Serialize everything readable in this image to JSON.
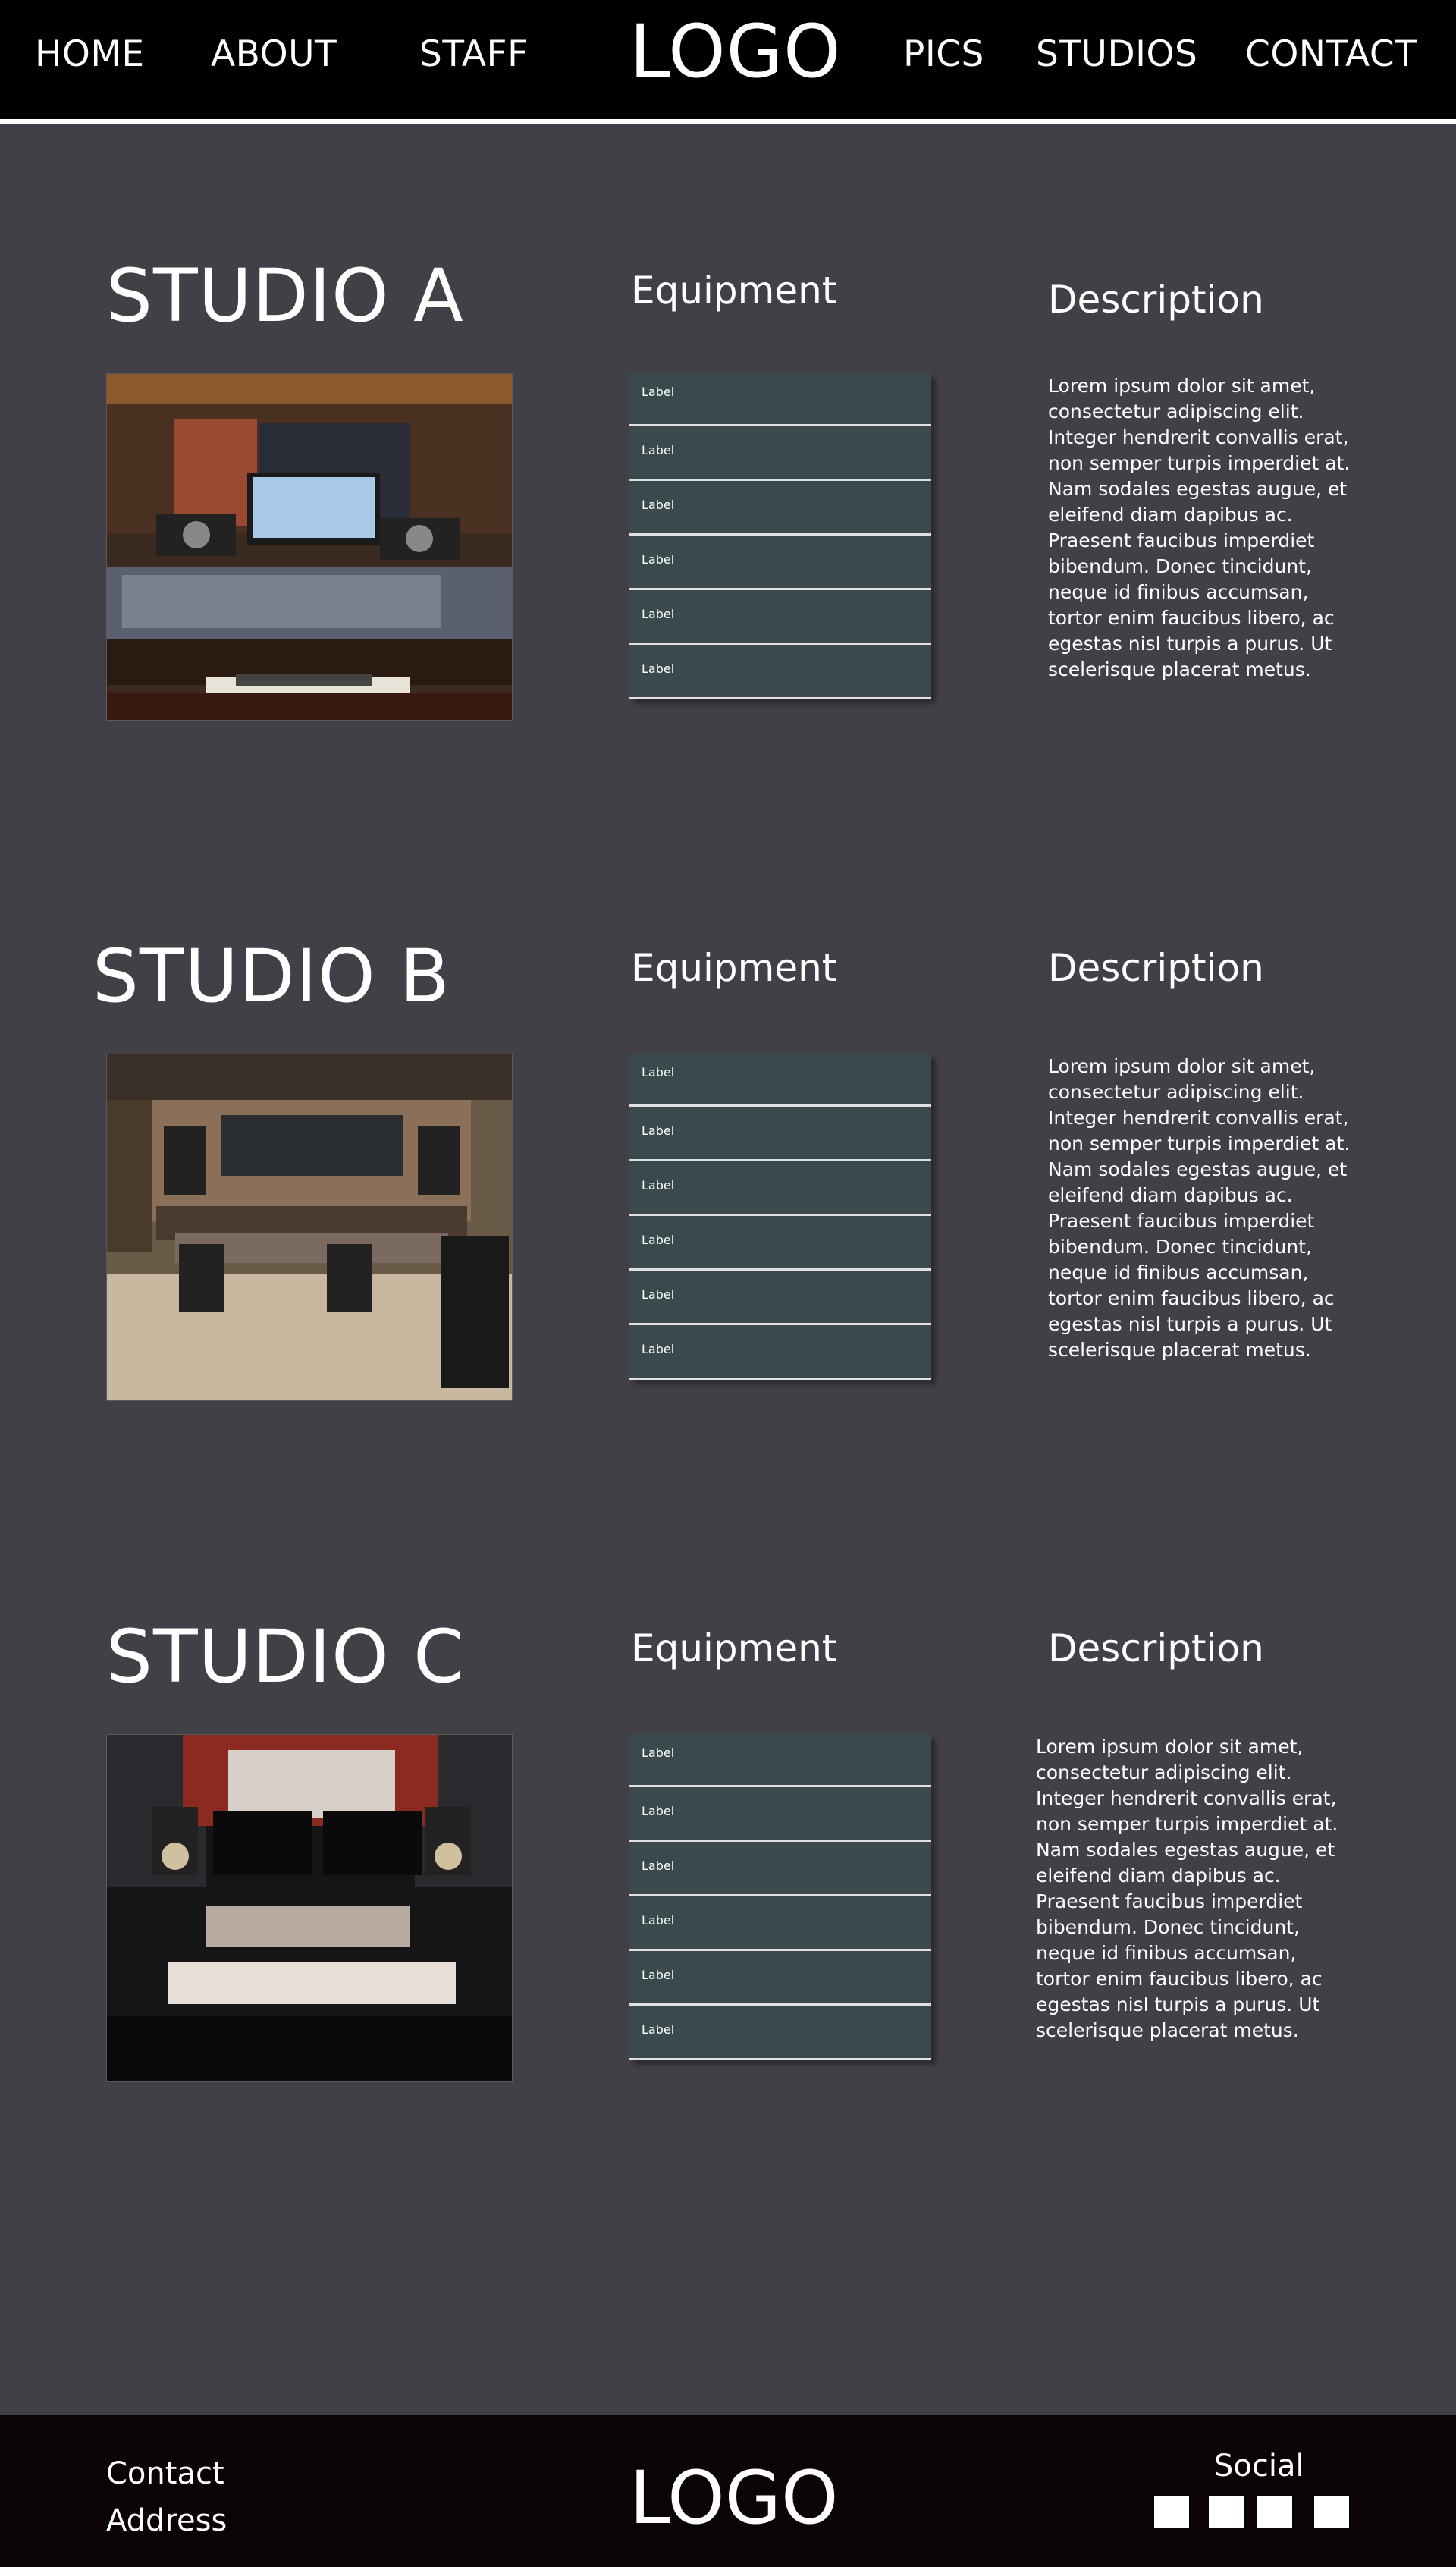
{
  "nav": {
    "home": "HOME",
    "about": "ABOUT",
    "staff": "STAFF",
    "logo": "LOGO",
    "pics": "PICS",
    "studios": "STUDIOS",
    "contact": "CONTACT"
  },
  "studios": [
    {
      "title": "STUDIO A",
      "equipment_heading": "Equipment",
      "description_heading": "Description",
      "equipment": [
        "Label",
        "Label",
        "Label",
        "Label",
        "Label",
        "Label"
      ],
      "description": "Lorem ipsum dolor sit amet, consectetur adipiscing elit. Integer hendrerit convallis erat, non semper turpis imperdiet at. Nam sodales egestas augue, et eleifend diam dapibus ac. Praesent faucibus imperdiet bibendum. Donec tincidunt, neque id finibus accumsan, tortor enim faucibus libero, ac egestas nisl turpis a purus. Ut scelerisque placerat metus."
    },
    {
      "title": "STUDIO B",
      "equipment_heading": "Equipment",
      "description_heading": "Description",
      "equipment": [
        "Label",
        "Label",
        "Label",
        "Label",
        "Label",
        "Label"
      ],
      "description": "Lorem ipsum dolor sit amet, consectetur adipiscing elit. Integer hendrerit convallis erat, non semper turpis imperdiet at. Nam sodales egestas augue, et eleifend diam dapibus ac. Praesent faucibus imperdiet bibendum. Donec tincidunt, neque id finibus accumsan, tortor enim faucibus libero, ac egestas nisl turpis a purus. Ut scelerisque placerat metus."
    },
    {
      "title": "STUDIO C",
      "equipment_heading": "Equipment",
      "description_heading": "Description",
      "equipment": [
        "Label",
        "Label",
        "Label",
        "Label",
        "Label",
        "Label"
      ],
      "description": "Lorem ipsum dolor sit amet, consectetur adipiscing elit. Integer hendrerit convallis erat, non semper turpis imperdiet at. Nam sodales egestas augue, et eleifend diam dapibus ac. Praesent faucibus imperdiet bibendum. Donec tincidunt, neque id finibus accumsan, tortor enim faucibus libero, ac egestas nisl turpis a purus. Ut scelerisque placerat metus."
    }
  ],
  "footer": {
    "contact": "Contact",
    "address": "Address",
    "logo": "LOGO",
    "social": "Social"
  },
  "colors": {
    "page_background": "#414047",
    "header_background": "#000000",
    "footer_background": "#0b0405",
    "equipment_item": "#3a4a4c",
    "text": "#ffffff"
  }
}
